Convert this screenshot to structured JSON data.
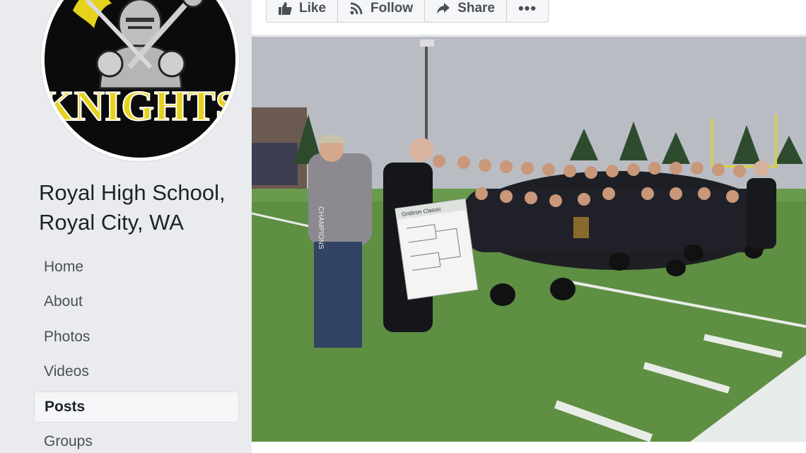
{
  "page": {
    "name": "Royal High School, Royal City, WA"
  },
  "logo": {
    "text": "KNIGHTS"
  },
  "actions": {
    "like_label": "Like",
    "follow_label": "Follow",
    "share_label": "Share",
    "more_label": "•••"
  },
  "sidebar": {
    "items": [
      {
        "label": "Home"
      },
      {
        "label": "About"
      },
      {
        "label": "Photos"
      },
      {
        "label": "Videos"
      },
      {
        "label": "Posts",
        "active": true
      },
      {
        "label": "Groups"
      }
    ]
  },
  "photo": {
    "banner_label": "Gridiron Classic",
    "jersey_text": "CHAMPIONS"
  },
  "colors": {
    "page_bg": "#e9ebee",
    "text_primary": "#1d2129",
    "button_text": "#4b4f56",
    "field_green": "#5f9144",
    "logo_yellow": "#e6d21c"
  }
}
